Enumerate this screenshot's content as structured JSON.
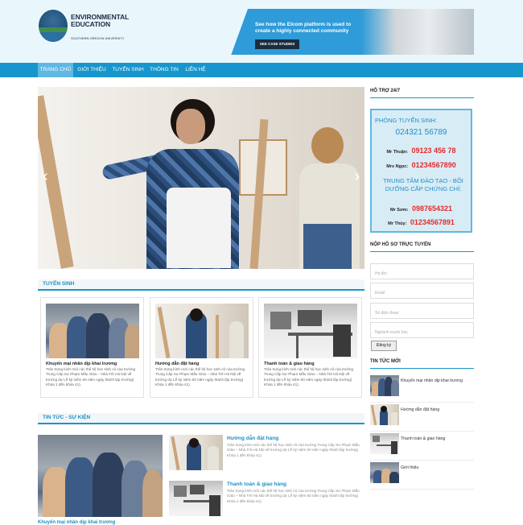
{
  "header": {
    "logo_line1": "ENVIRONMENTAL",
    "logo_line2": "EDUCATION",
    "logo_sub": "SOUTHERN OREGON UNIVERSITY",
    "ad_text": "See how the Elcom platform is used to create a highly connected community",
    "ad_button": "SEE CASE STUDIES"
  },
  "nav": {
    "items": [
      "TRANG CHỦ",
      "GIỚI THIỆU",
      "TUYỂN SINH",
      "THÔNG TIN",
      "LIÊN HỆ"
    ]
  },
  "slider": {
    "prev": "‹",
    "next": "›"
  },
  "tuyen_sinh": {
    "heading": "TUYỂN SINH",
    "cards": [
      {
        "title": "Khuyến mại nhân dịp khai trương",
        "desc": "Trân trọng kính mời các thể hệ học sinh cũ của trường Trung Cấp Sư Phạm Mẫu Giáo – Nhà Trẻ Hà Nội về trường dự Lễ kỷ niệm 60 năm ngày thành lập trường( Khóa 1 đến khóa 41)."
      },
      {
        "title": "Hướng dẫn đặt hàng",
        "desc": "Trân trọng kính mời các thể hệ học sinh cũ của trường Trung Cấp Sư Phạm Mẫu Giáo – Nhà Trẻ Hà Nội về trường dự Lễ kỷ niệm 60 năm ngày thành lập trường( Khóa 1 đến khóa 41)."
      },
      {
        "title": "Thanh toán & giao hàng",
        "desc": "Trân trọng kính mời các thể hệ học sinh cũ của trường Trung Cấp Sư Phạm Mẫu Giáo – Nhà Trẻ Hà Nội về trường dự Lễ kỷ niệm 60 năm ngày thành lập trường( Khóa 1 đến khóa 41)."
      }
    ]
  },
  "news": {
    "heading": "TIN TỨC - SỰ KIỆN",
    "big_title": "Khuyến mại nhân dịp khai trương",
    "items": [
      {
        "title": "Hướng dẫn đặt hàng",
        "desc": "Trân trọng kính mời các thể hệ học sinh cũ của trường Trung Cấp Sư Phạm Mẫu Giáo – Nhà Trẻ Hà Nội về trường dự Lễ kỷ niệm 60 năm ngày thành lập trường( Khóa 1 đến khóa 41)."
      },
      {
        "title": "Thanh toán & giao hàng",
        "desc": "Trân trọng kính mời các thể hệ học sinh cũ của trường Trung Cấp Sư Phạm Mẫu Giáo – Nhà Trẻ Hà Nội về trường dự Lễ kỷ niệm 60 năm ngày thành lập trường( Khóa 1 đến khóa 41)."
      }
    ]
  },
  "sidebar": {
    "support_heading": "HỖ TRỢ 24/7",
    "admissions_label": "PHÒNG TUYỂN SINH:",
    "admissions_phone": "024321 56789",
    "contacts1": [
      {
        "name": "Mr Thuận:",
        "phone": "09123 456 78"
      },
      {
        "name": "Mrs Ngọc:",
        "phone": "01234567890"
      }
    ],
    "training_label": "TRUNG TÂM ĐÀO TẠO - BỒI DƯỠNG CẤP CHỨNG CHỈ:",
    "contacts2": [
      {
        "name": "Mr Sơm:",
        "phone": "0987654321"
      },
      {
        "name": "Mr Thủy:",
        "phone": "01234567891"
      }
    ],
    "apply_heading": "NỘP HỒ SƠ TRỰC TUYẾN",
    "form": {
      "name_placeholder": "Họ tên",
      "email_placeholder": "Email",
      "phone_placeholder": "Số điện thoại",
      "major_placeholder": "Nghành muốn học",
      "submit_label": "Đăng ký"
    },
    "latest_heading": "TIN TỨC MỚI",
    "latest": [
      "Khuyến mại nhân dịp khai trương",
      "Hướng dẫn đặt hàng",
      "Thanh toán & giao hàng",
      "Giới thiệu"
    ]
  }
}
